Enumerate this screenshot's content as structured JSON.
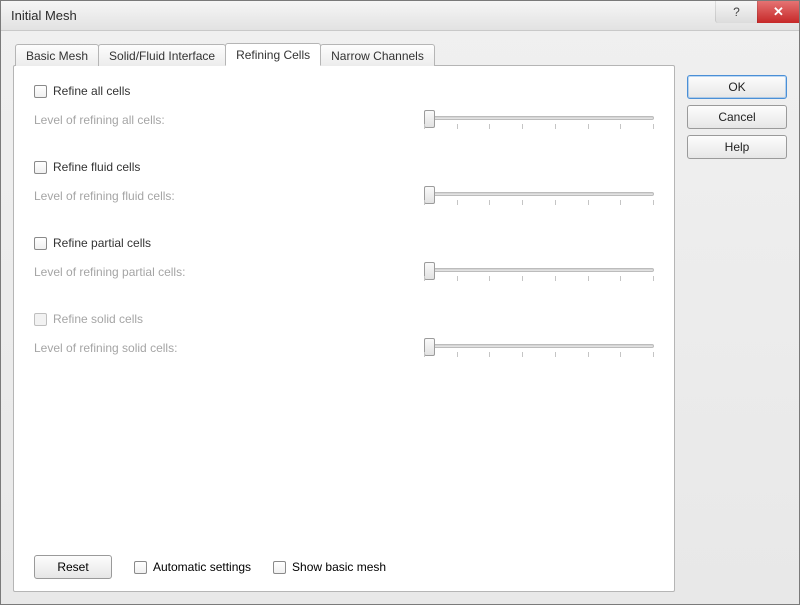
{
  "title": "Initial Mesh",
  "tabs": [
    {
      "label": "Basic Mesh"
    },
    {
      "label": "Solid/Fluid Interface"
    },
    {
      "label": "Refining Cells"
    },
    {
      "label": "Narrow Channels"
    }
  ],
  "active_tab": 2,
  "options": [
    {
      "checkbox_label": "Refine all cells",
      "level_label": "Level of refining all cells:",
      "enabled": true
    },
    {
      "checkbox_label": "Refine fluid cells",
      "level_label": "Level of refining fluid cells:",
      "enabled": true
    },
    {
      "checkbox_label": "Refine partial cells",
      "level_label": "Level of refining partial cells:",
      "enabled": true
    },
    {
      "checkbox_label": "Refine solid cells",
      "level_label": "Level of refining solid cells:",
      "enabled": false
    }
  ],
  "bottom": {
    "reset": "Reset",
    "automatic": "Automatic settings",
    "show_basic": "Show basic mesh"
  },
  "side": {
    "ok": "OK",
    "cancel": "Cancel",
    "help": "Help"
  },
  "titlebar": {
    "help_glyph": "?",
    "close_glyph": "✕"
  }
}
